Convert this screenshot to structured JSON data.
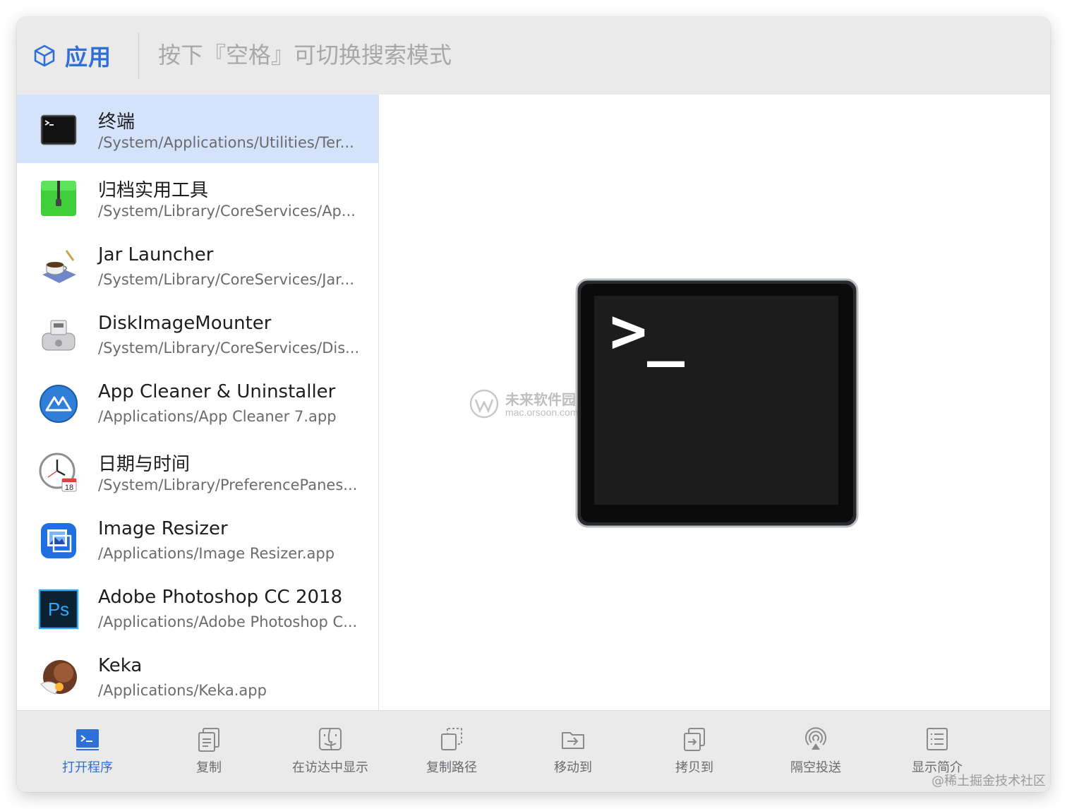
{
  "header": {
    "mode_label": "应用",
    "search_placeholder": "按下『空格』可切换搜索模式"
  },
  "results": [
    {
      "title": "终端",
      "path": "/System/Applications/Utilities/Ter...",
      "icon": "terminal-icon",
      "selected": true
    },
    {
      "title": "归档实用工具",
      "path": "/System/Library/CoreServices/Ap...",
      "icon": "archive-utility-icon"
    },
    {
      "title": "Jar Launcher",
      "path": "/System/Library/CoreServices/Jar...",
      "icon": "jar-launcher-icon"
    },
    {
      "title": "DiskImageMounter",
      "path": "/System/Library/CoreServices/Dis...",
      "icon": "disk-image-mounter-icon"
    },
    {
      "title": "App Cleaner & Uninstaller",
      "path": "/Applications/App Cleaner 7.app",
      "icon": "app-cleaner-icon"
    },
    {
      "title": "日期与时间",
      "path": "/System/Library/PreferencePanes...",
      "icon": "date-time-icon",
      "badge": "18"
    },
    {
      "title": "Image Resizer",
      "path": "/Applications/Image Resizer.app",
      "icon": "image-resizer-icon"
    },
    {
      "title": "Adobe Photoshop CC 2018",
      "path": "/Applications/Adobe Photoshop C...",
      "icon": "photoshop-icon",
      "badge": "Ps"
    },
    {
      "title": "Keka",
      "path": "/Applications/Keka.app",
      "icon": "keka-icon"
    }
  ],
  "preview": {
    "icon": "terminal-icon-large",
    "prompt_glyph": ">_",
    "watermark_title": "未来软件园",
    "watermark_url": "mac.orsoon.com"
  },
  "actions": [
    {
      "label": "打开程序",
      "icon": "open-app-icon",
      "active": true
    },
    {
      "label": "复制",
      "icon": "copy-icon"
    },
    {
      "label": "在访达中显示",
      "icon": "finder-icon"
    },
    {
      "label": "复制路径",
      "icon": "copy-path-icon"
    },
    {
      "label": "移动到",
      "icon": "move-to-icon"
    },
    {
      "label": "拷贝到",
      "icon": "copy-to-icon"
    },
    {
      "label": "隔空投送",
      "icon": "airdrop-icon"
    },
    {
      "label": "显示简介",
      "icon": "info-icon"
    }
  ],
  "credit": "@稀土掘金技术社区",
  "colors": {
    "accent": "#2f6fd8",
    "selection": "#d4e3fb",
    "chrome": "#eaeaeb"
  }
}
